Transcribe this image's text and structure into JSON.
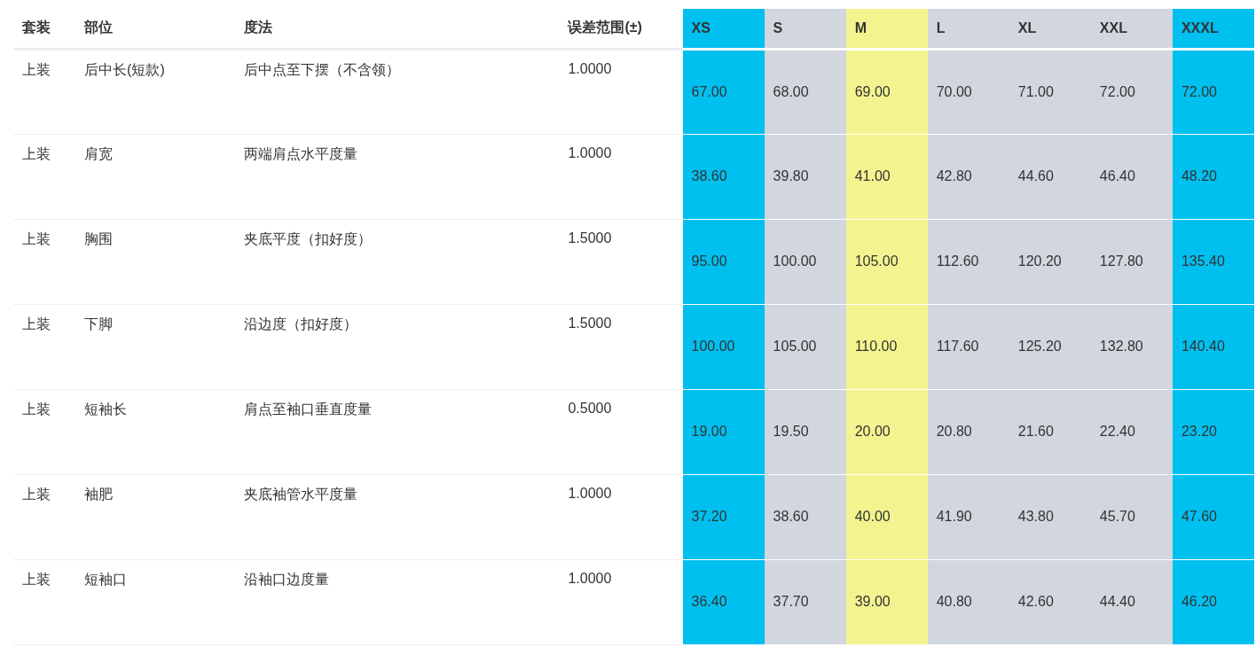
{
  "columns": [
    "套装",
    "部位",
    "度法",
    "误差范围(±)"
  ],
  "size_columns": [
    {
      "label": "XS",
      "color": "#00c0ef"
    },
    {
      "label": "S",
      "color": "#d2d6de"
    },
    {
      "label": "M",
      "color": "#f3f48f"
    },
    {
      "label": "L",
      "color": "#d2d6de"
    },
    {
      "label": "XL",
      "color": "#d2d6de"
    },
    {
      "label": "XXL",
      "color": "#d2d6de"
    },
    {
      "label": "XXXL",
      "color": "#00c0ef"
    }
  ],
  "rows": [
    {
      "set": "上装",
      "part": "后中长(短款)",
      "method": "后中点至下摆（不含领）",
      "tolerance": "1.0000",
      "sizes": [
        "67.00",
        "68.00",
        "69.00",
        "70.00",
        "71.00",
        "72.00",
        "72.00"
      ]
    },
    {
      "set": "上装",
      "part": "肩宽",
      "method": "两端肩点水平度量",
      "tolerance": "1.0000",
      "sizes": [
        "38.60",
        "39.80",
        "41.00",
        "42.80",
        "44.60",
        "46.40",
        "48.20"
      ]
    },
    {
      "set": "上装",
      "part": "胸围",
      "method": "夹底平度（扣好度）",
      "tolerance": "1.5000",
      "sizes": [
        "95.00",
        "100.00",
        "105.00",
        "112.60",
        "120.20",
        "127.80",
        "135.40"
      ]
    },
    {
      "set": "上装",
      "part": "下脚",
      "method": "沿边度（扣好度）",
      "tolerance": "1.5000",
      "sizes": [
        "100.00",
        "105.00",
        "110.00",
        "117.60",
        "125.20",
        "132.80",
        "140.40"
      ]
    },
    {
      "set": "上装",
      "part": "短袖长",
      "method": "肩点至袖口垂直度量",
      "tolerance": "0.5000",
      "sizes": [
        "19.00",
        "19.50",
        "20.00",
        "20.80",
        "21.60",
        "22.40",
        "23.20"
      ]
    },
    {
      "set": "上装",
      "part": "袖肥",
      "method": "夹底袖管水平度量",
      "tolerance": "1.0000",
      "sizes": [
        "37.20",
        "38.60",
        "40.00",
        "41.90",
        "43.80",
        "45.70",
        "47.60"
      ]
    },
    {
      "set": "上装",
      "part": "短袖口",
      "method": "沿袖口边度量",
      "tolerance": "1.0000",
      "sizes": [
        "36.40",
        "37.70",
        "39.00",
        "40.80",
        "42.60",
        "44.40",
        "46.20"
      ]
    }
  ]
}
